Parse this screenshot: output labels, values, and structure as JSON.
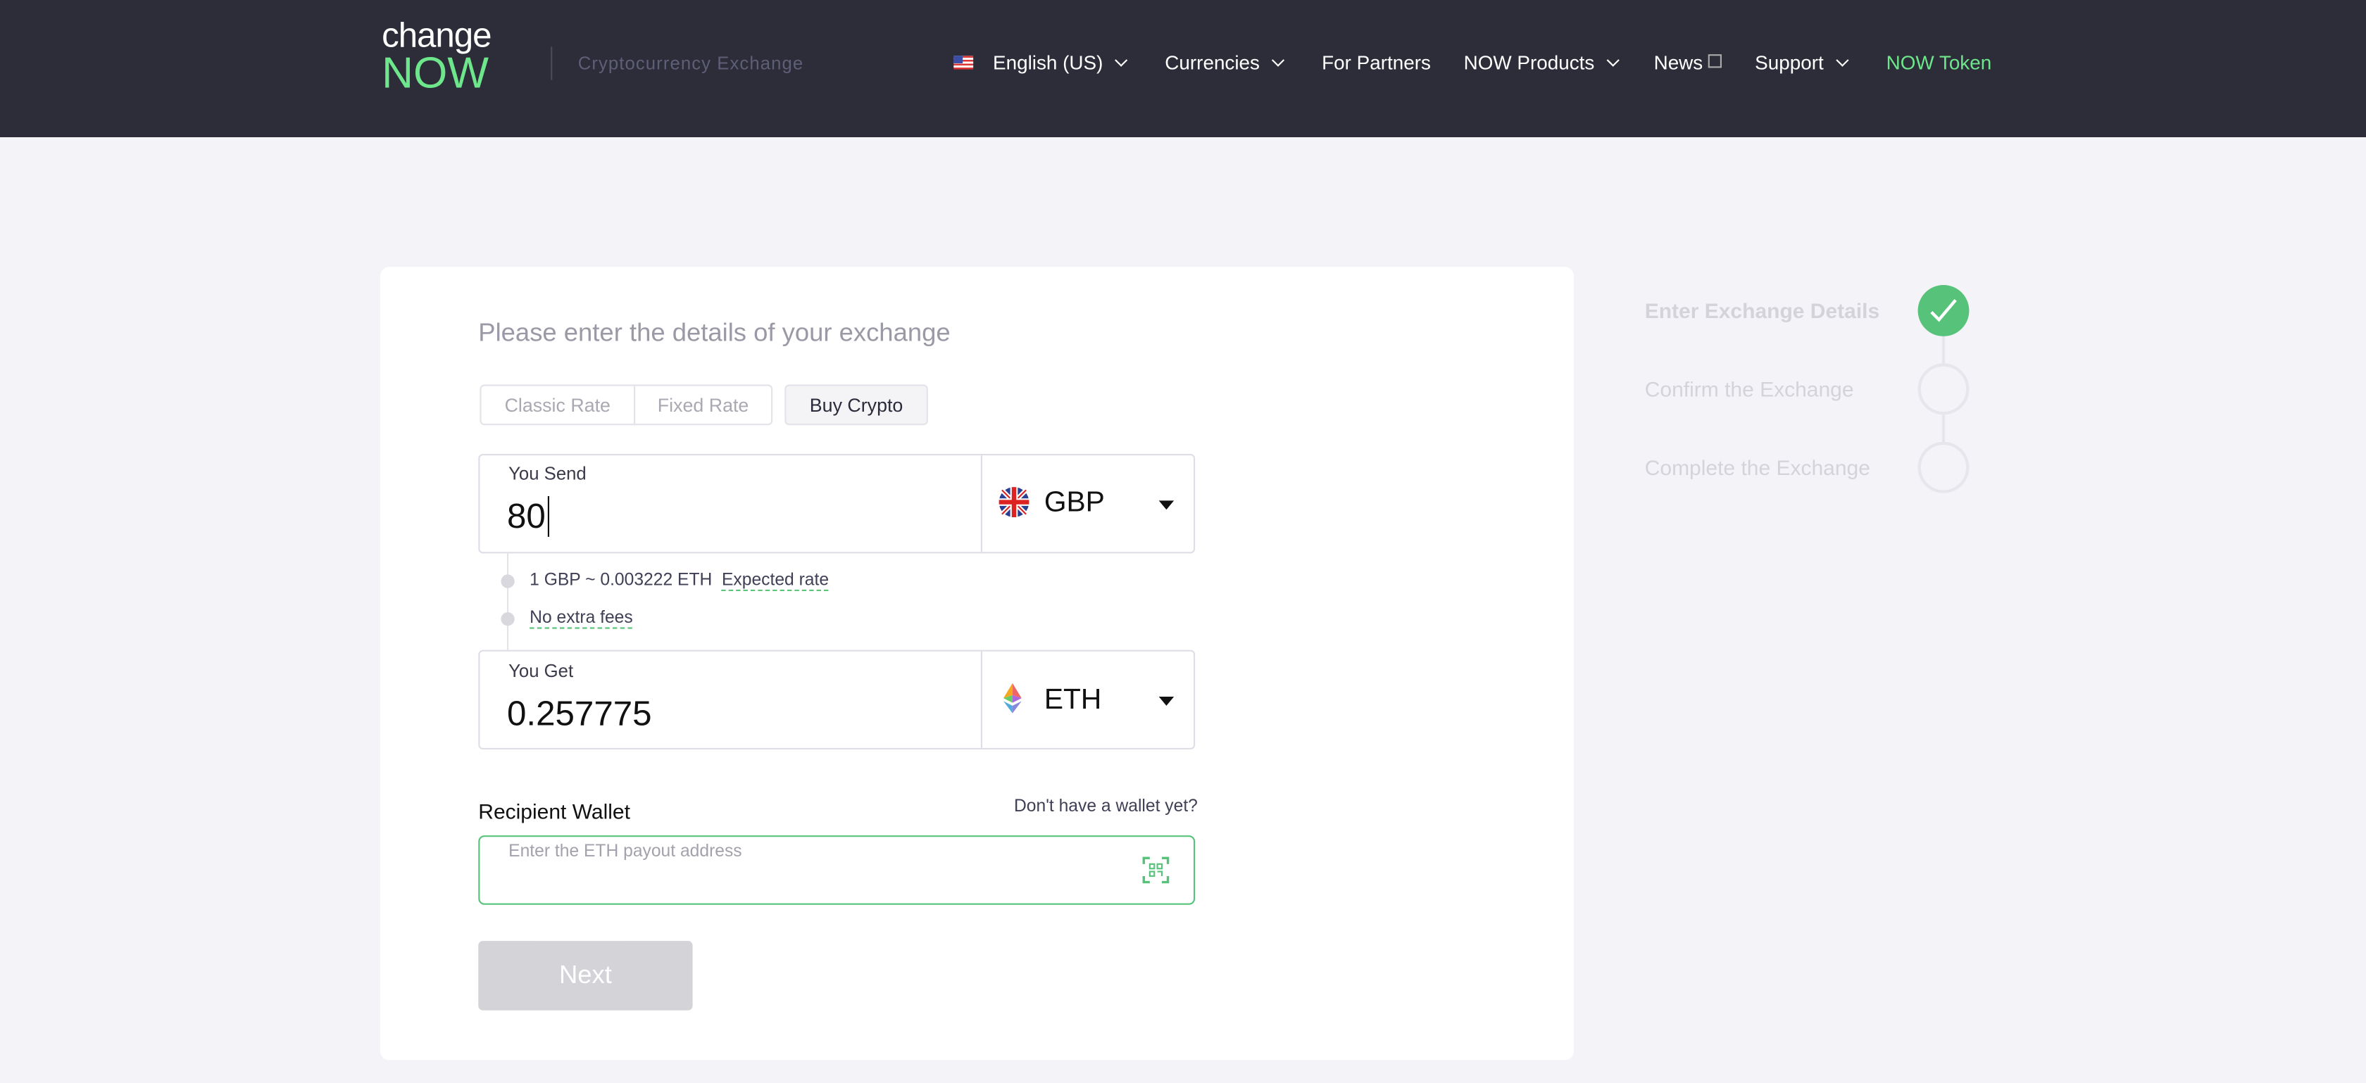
{
  "header": {
    "logo_top": "change",
    "logo_bottom": "NOW",
    "tagline": "Cryptocurrency Exchange",
    "nav": [
      {
        "label": "English (US)",
        "icon": "us-flag-icon",
        "dropdown": true
      },
      {
        "label": "Currencies",
        "dropdown": true
      },
      {
        "label": "For Partners"
      },
      {
        "label": "NOW Products",
        "dropdown": true
      },
      {
        "label": "News",
        "icon": "external-link-icon"
      },
      {
        "label": "Support",
        "dropdown": true
      },
      {
        "label": "NOW Token",
        "color": "#6ee68b"
      }
    ]
  },
  "form": {
    "title": "Please enter the details of your exchange",
    "tabs": [
      "Classic Rate",
      "Fixed Rate",
      "Buy Crypto"
    ],
    "active_tab": "Buy Crypto",
    "send": {
      "label": "You Send",
      "value": "80",
      "currency": "GBP",
      "icon": "uk-flag-icon"
    },
    "rate_text": "1 GBP ~ 0.003222 ETH",
    "expected_rate": "Expected rate",
    "no_fees": "No extra fees",
    "get": {
      "label": "You Get",
      "value": "0.257775",
      "currency": "ETH",
      "icon": "ethereum-icon"
    },
    "wallet_label": "Recipient Wallet",
    "wallet_link": "Don't have a wallet yet?",
    "wallet_placeholder": "Enter the ETH payout address",
    "next": "Next"
  },
  "steps": [
    {
      "label": "Enter Exchange Details",
      "done": true
    },
    {
      "label": "Confirm the Exchange",
      "done": false
    },
    {
      "label": "Complete the Exchange",
      "done": false
    }
  ],
  "colors": {
    "accent": "#57c27a",
    "header_bg": "#2c2d38",
    "page_bg": "#f4f3f8"
  }
}
